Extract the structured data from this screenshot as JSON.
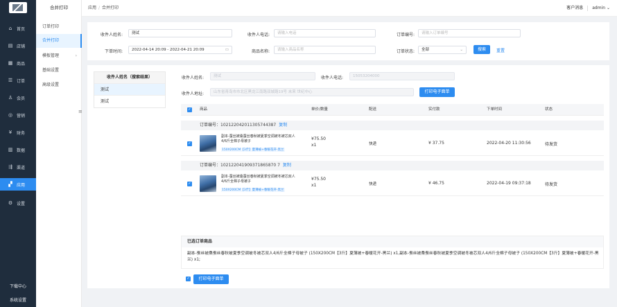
{
  "sidebar": {
    "items": [
      {
        "label": "首页",
        "icon": "home-icon",
        "glyph": "⌂"
      },
      {
        "label": "店铺",
        "icon": "store-icon",
        "glyph": "▤"
      },
      {
        "label": "商品",
        "icon": "goods-icon",
        "glyph": "▦"
      },
      {
        "label": "订单",
        "icon": "order-icon",
        "glyph": "☰"
      },
      {
        "label": "会员",
        "icon": "member-icon",
        "glyph": "♙"
      },
      {
        "label": "营销",
        "icon": "marketing-icon",
        "glyph": "◎"
      },
      {
        "label": "财务",
        "icon": "finance-icon",
        "glyph": "¥"
      },
      {
        "label": "数据",
        "icon": "data-icon",
        "glyph": "▥"
      },
      {
        "label": "渠道",
        "icon": "channel-icon",
        "glyph": "⇶"
      },
      {
        "label": "应用",
        "icon": "apps-icon",
        "glyph": "▞"
      },
      {
        "label": "设置",
        "icon": "settings-icon",
        "glyph": "⚙"
      }
    ],
    "active_index": 9,
    "download_center": "下载中心",
    "system_settings": "系统设置"
  },
  "submenu": {
    "title": "合并打印",
    "items": [
      {
        "label": "订单打印"
      },
      {
        "label": "合并打印"
      },
      {
        "label": "模板管理"
      },
      {
        "label": "基础设置"
      },
      {
        "label": "高级设置"
      }
    ],
    "active_index": 1,
    "arrow": "›",
    "collapse_glyph": "≡"
  },
  "header": {
    "breadcrumb": [
      "应用",
      "合并打印"
    ],
    "breadcrumb_sep": "/",
    "messages": "客户消息",
    "user": "admin",
    "user_caret": "⌄"
  },
  "filters": {
    "name_label": "收件人姓名:",
    "name_value": "测试",
    "phone_label": "收件人电话:",
    "phone_placeholder": "请输入电话",
    "order_no_label": "订单编号:",
    "order_no_placeholder": "请输入订单编号",
    "time_label": "下单时间:",
    "time_value": "2022-04-14 20:09 - 2022-04-21 20:09",
    "product_label": "商品名称:",
    "product_placeholder": "请输入商品名称",
    "status_label": "订单状态:",
    "status_value": "全部",
    "search_btn": "搜索",
    "reset_btn": "重置",
    "calendar_glyph": "▭",
    "select_caret": "⌄"
  },
  "results": {
    "header": "收件人姓名（搜索结果）",
    "rows": [
      "测试",
      "测试"
    ]
  },
  "recipient": {
    "name_label": "收件人姓名:",
    "name_value": "测试",
    "phone_label": "收件人电话:",
    "phone_value": "15053204000",
    "address_label": "收件人地址:",
    "address_value": "山东省青岛市市北区黑龙江南路双城路19号 未来 世纪中心",
    "print_btn": "打印电子面单"
  },
  "table": {
    "columns": [
      "商品",
      "单价/数量",
      "配送",
      "实付款",
      "下单时间",
      "状态"
    ],
    "check_glyph": "✓",
    "copy_label": "复制",
    "orders": [
      {
        "order_label": "订单编号：",
        "order_no": "102122042011305744387",
        "title": "副本-蚕丝被桑蚕丝春秋被夏季空调被冬被芯双人4/6斤全棉子母被子",
        "spec": "150X200CM【3斤】夏薄被+春暖花开-黑兰",
        "price": "¥75.50",
        "qty": "x1",
        "delivery": "快递",
        "paid": "¥ 37.75",
        "time": "2022-04-20 11:30:56",
        "status": "待发货"
      },
      {
        "order_label": "订单编号：",
        "order_no": "102122041909371865870 7",
        "title": "副本-蚕丝被桑蚕丝春秋被夏季空调被冬被芯双人4/6斤全棉子母被子",
        "spec": "150X200CM【3斤】夏薄被+春暖花开-黑兰",
        "price": "¥75.50",
        "qty": "x1",
        "delivery": "快递",
        "paid": "¥ 46.75",
        "time": "2022-04-19 09:37:18",
        "status": "待发货"
      }
    ]
  },
  "selected": {
    "title": "已选订单商品",
    "text": "副本-蚕丝被桑蚕丝春秋被夏季空调被冬被芯双人4/6斤全棉子母被子 (150X200CM【3斤】夏薄被+春暖花开-黑兰) x1,副本-蚕丝被桑蚕丝春秋被夏季空调被冬被芯双人4/6斤全棉子母被子 (150X200CM【3斤】夏薄被+春暖花开-黑兰) x1;"
  },
  "footer": {
    "print_btn": "打印电子面单"
  },
  "colors": {
    "accent": "#2d8cf0",
    "sidebar_bg": "#1f2d3d"
  }
}
